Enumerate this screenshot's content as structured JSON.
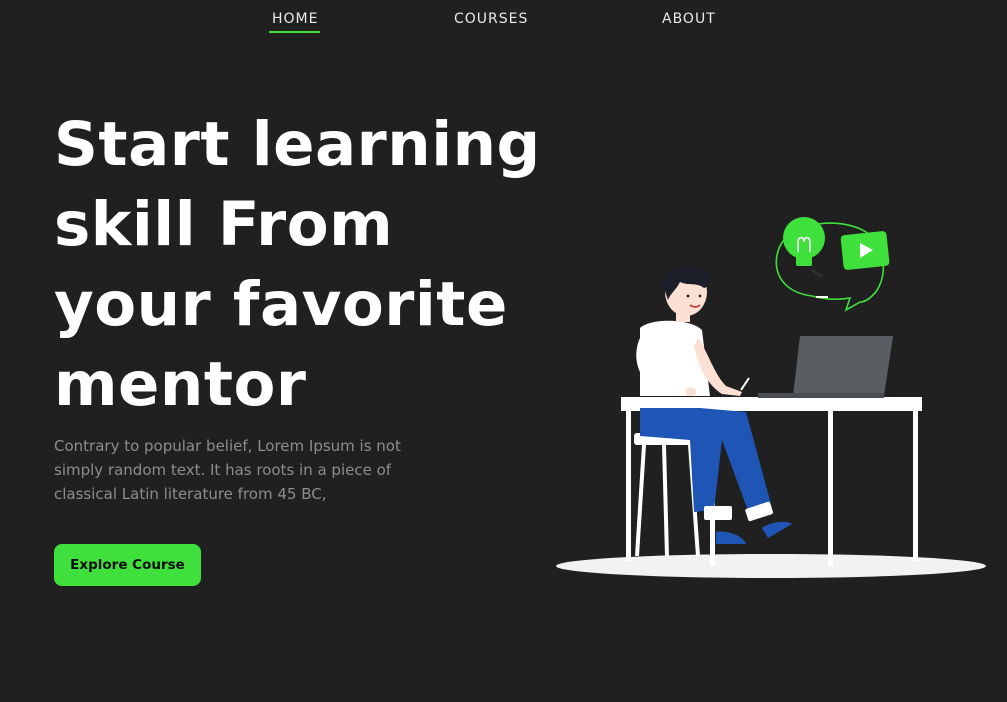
{
  "nav": {
    "items": [
      {
        "label": "HOME",
        "active": true
      },
      {
        "label": "COURSES",
        "active": false
      },
      {
        "label": "ABOUT",
        "active": false
      }
    ]
  },
  "hero": {
    "title_lines": [
      "Start learning",
      "skill From",
      "your favorite",
      "mentor"
    ],
    "description": "Contrary to popular belief, Lorem Ipsum is not simply random text. It has roots in a piece of classical Latin literature from 45 BC,",
    "cta_label": "Explore Course"
  },
  "illustration": {
    "icons": [
      "lightbulb-icon",
      "play-video-icon",
      "speech-bubble-icon"
    ],
    "scene": "person-at-desk-with-laptop"
  },
  "colors": {
    "background": "#202020",
    "accent": "#3fe03c",
    "text_primary": "#ffffff",
    "text_muted": "#8d8d8d"
  }
}
